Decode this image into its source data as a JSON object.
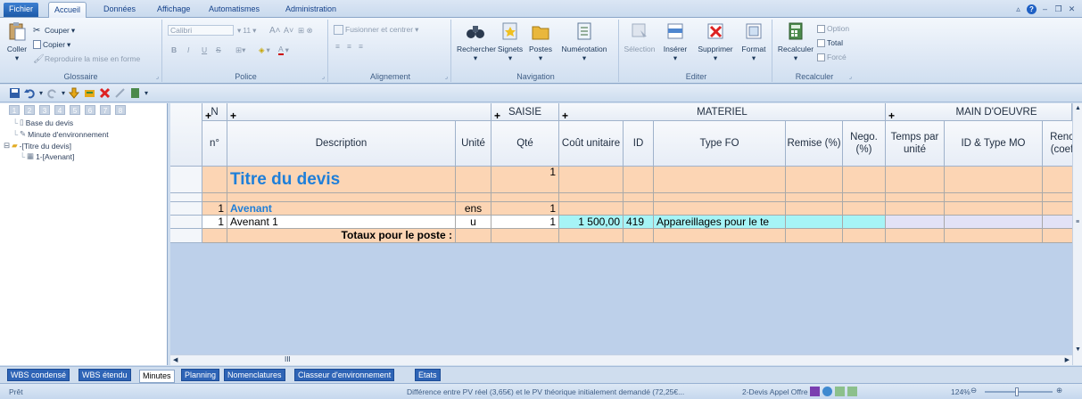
{
  "tabs": [
    "Fichier",
    "Accueil",
    "Données",
    "Affichage",
    "Automatismes",
    "Administration"
  ],
  "ribbon": {
    "glossaire": {
      "label": "Glossaire",
      "coller": "Coller",
      "couper": "Couper",
      "copier": "Copier",
      "reproduire": "Reproduire la mise en forme"
    },
    "police": {
      "label": "Police",
      "font": "Calibri",
      "size": "11",
      "bold": "B",
      "italic": "I",
      "underline": "U",
      "strike": "S"
    },
    "alignement": {
      "label": "Alignement",
      "fusionner": "Fusionner et centrer"
    },
    "navigation": {
      "label": "Navigation",
      "rechercher": "Rechercher",
      "signets": "Signets",
      "postes": "Postes",
      "numerotation": "Numérotation"
    },
    "editer": {
      "label": "Editer",
      "selection": "Sélection",
      "inserer": "Insérer",
      "supprimer": "Supprimer",
      "format": "Format"
    },
    "recalculer": {
      "label": "Recalculer",
      "button": "Recalculer",
      "option": "Option",
      "total": "Total",
      "force": "Forcé"
    }
  },
  "tree": {
    "levels": [
      "1",
      "2",
      "3",
      "4",
      "5",
      "6",
      "7",
      "8"
    ],
    "nodes": [
      "Base du devis",
      "Minute d'environnement",
      "-[Titre du devis]",
      "1-[Avenant]"
    ]
  },
  "grid": {
    "groups": {
      "n": "N",
      "saisie": "SAISIE",
      "materiel": "MATERIEL",
      "main_oeuvre": "MAIN D'OEUVRE"
    },
    "columns": {
      "n": "n°",
      "description": "Description",
      "unite": "Unité",
      "qte": "Qté",
      "cout": "Coût unitaire",
      "id": "ID",
      "type_fo": "Type FO",
      "remise": "Remise (%)",
      "nego": "Nego. (%)",
      "temps": "Temps par unité",
      "id_type_mo": "ID & Type MO",
      "rend": "Renc (coef"
    },
    "rows": {
      "title": {
        "description": "Titre du devis",
        "qte": "1"
      },
      "avenant": {
        "n": "1",
        "description": "Avenant",
        "unite": "ens",
        "qte": "1"
      },
      "avenant1": {
        "n": "1",
        "description": "Avenant 1",
        "unite": "u",
        "qte": "1",
        "cout": "1 500,00",
        "id": "419",
        "type_fo": "Appareillages pour le te"
      },
      "totaux": {
        "description": "Totaux pour le poste :"
      }
    },
    "hscroll_grip": "III"
  },
  "sheet_tabs": [
    "WBS condensé",
    "WBS étendu",
    "Minutes",
    "Planning",
    "Nomenclatures",
    "Classeur d'environnement",
    "Etats"
  ],
  "status": {
    "ready": "Prêt",
    "message": "Différence entre PV réel (3,65€) et le PV théorique initialement demandé (72,25€...",
    "document": "2-Devis Appel Offre",
    "zoom": "124%"
  },
  "colors": {
    "title_row": "#fcd5b4",
    "title_text": "#1f7fd9",
    "cyan": "#a6f4f6",
    "lavender": "#e2e2f6",
    "grid_bg": "#bdd0ea"
  }
}
